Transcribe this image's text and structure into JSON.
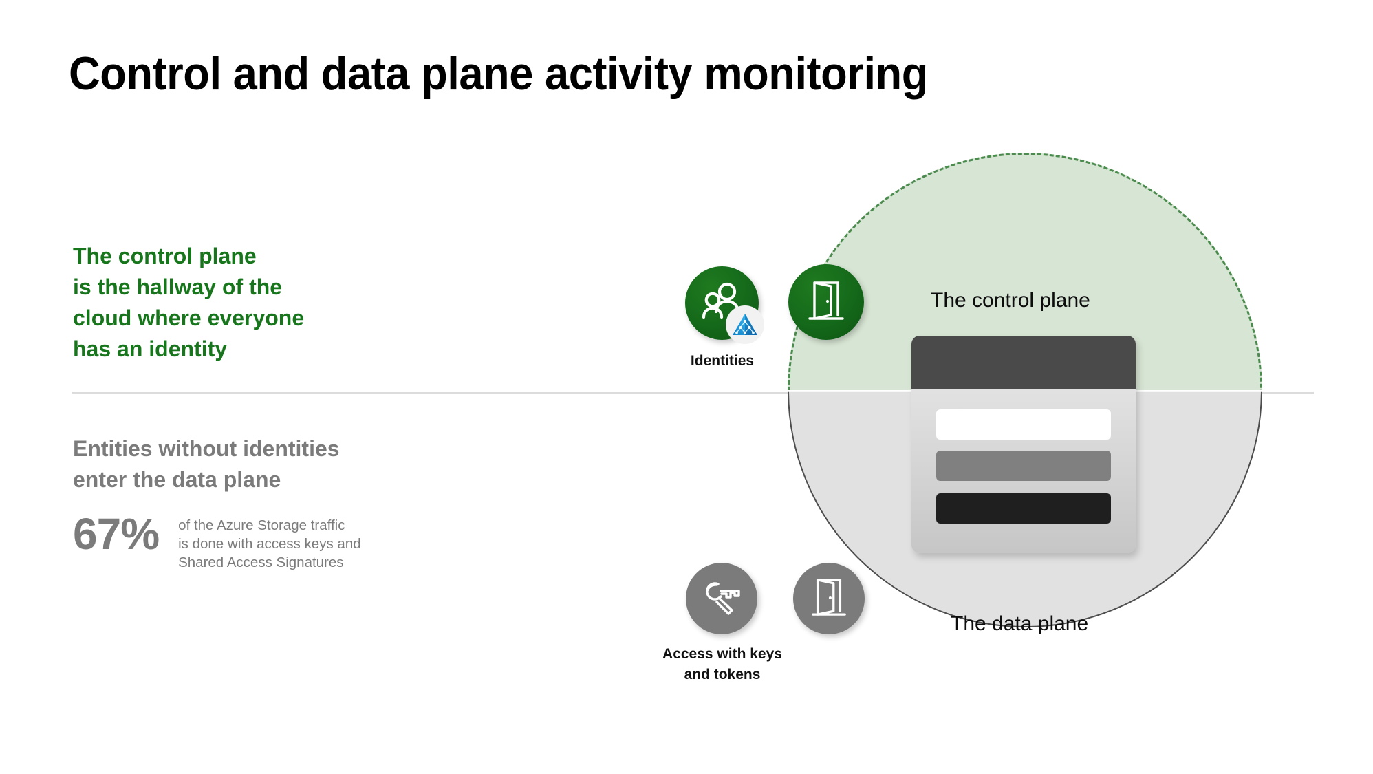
{
  "slide": {
    "title": "Control and data plane activity monitoring",
    "background": "#ffffff"
  },
  "colors": {
    "green_text": "#17761c",
    "gray_text": "#7b7b7b",
    "control_plane_fill": "#d7e5d4",
    "control_plane_border": "#4b8c4e",
    "data_plane_fill": "#e1e1e1",
    "data_plane_border": "#4d4d4d",
    "icon_green": "#14691a",
    "icon_gray": "#7b7b7b",
    "divider": "#dcdcdc",
    "card_header": "#4a4a4a",
    "card_row_light": "#ffffff",
    "card_row_mid": "#808080",
    "card_row_dark": "#1f1f1f",
    "aad_blue": "#1e9bdc"
  },
  "left_column": {
    "control_plane_statement": "The control plane\nis the hallway of the\ncloud where everyone\nhas an identity",
    "data_plane_statement": "Entities without identities\nenter the data plane",
    "stat": {
      "value": "67%",
      "caption": "of the Azure Storage traffic\nis done with access keys and\nShared Access Signatures"
    }
  },
  "diagram": {
    "control_plane_label": "The control plane",
    "data_plane_label": "The data plane",
    "icons": [
      {
        "id": "identities",
        "caption": "Identities",
        "glyph": "people-icon",
        "badge": "azure-active-directory-icon",
        "tone": "green"
      },
      {
        "id": "control-plane-door",
        "caption": "",
        "glyph": "open-door-icon",
        "tone": "green"
      },
      {
        "id": "access-keys",
        "caption": "Access with keys\nand tokens",
        "glyph": "keys-icon",
        "tone": "gray"
      },
      {
        "id": "data-plane-door",
        "caption": "",
        "glyph": "open-door-icon",
        "tone": "gray"
      }
    ],
    "card": {
      "description": "storage-resource-card",
      "rows": [
        "row-light",
        "row-mid",
        "row-dark"
      ]
    }
  }
}
